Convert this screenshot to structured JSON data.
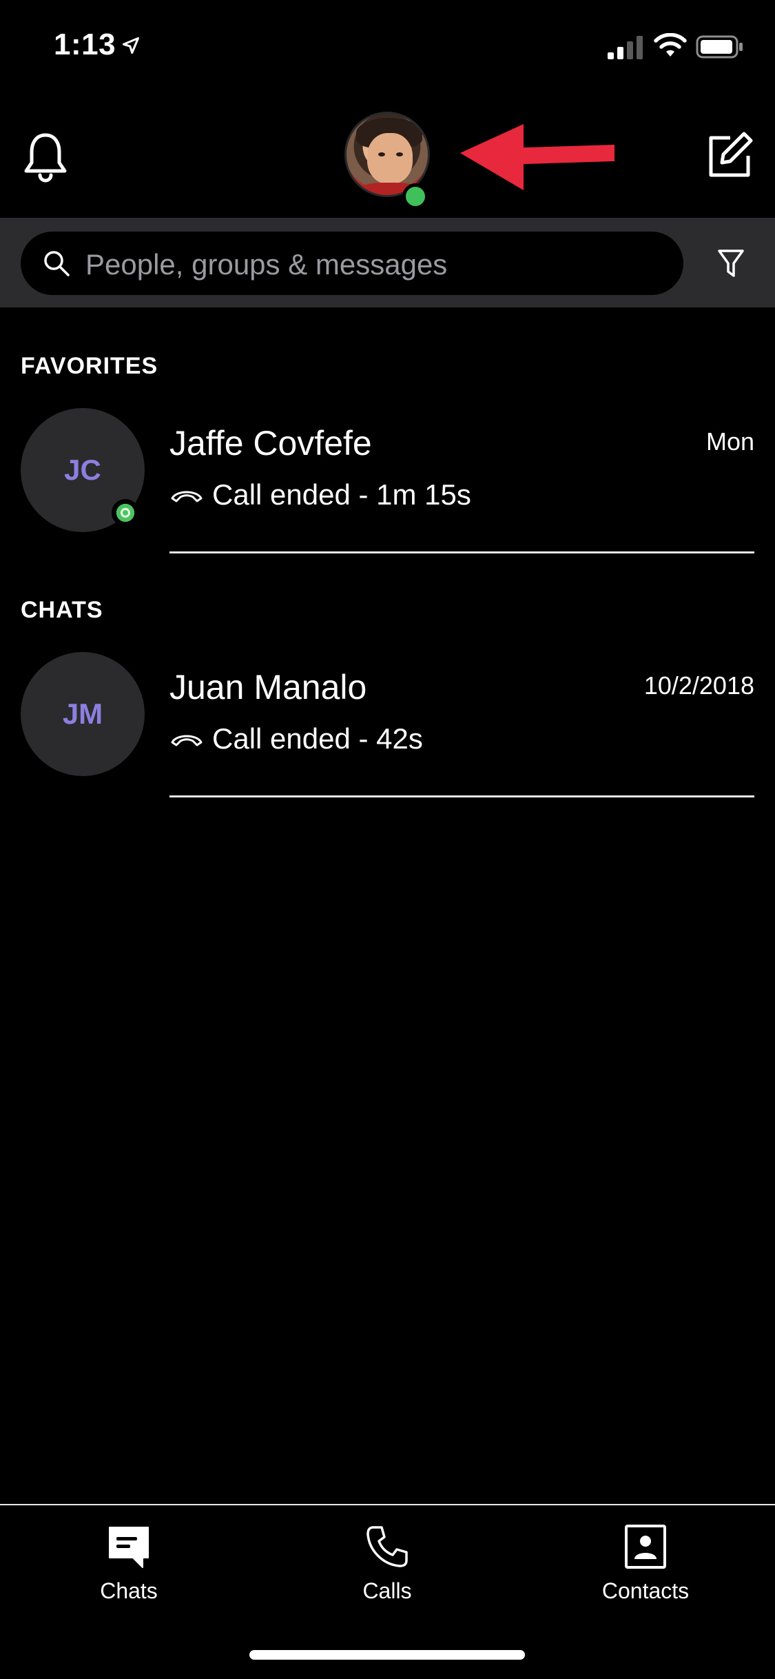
{
  "status_bar": {
    "time": "1:13",
    "icons": [
      "location-arrow-icon",
      "signal-icon",
      "wifi-icon",
      "battery-icon"
    ]
  },
  "header": {
    "left_icon": "bell-icon",
    "right_icon": "compose-icon",
    "profile_status": "online",
    "annotation": "red-arrow pointing to profile avatar"
  },
  "search": {
    "placeholder": "People, groups & messages",
    "filter_icon": "filter-icon"
  },
  "sections": {
    "favorites_label": "FAVORITES",
    "chats_label": "CHATS"
  },
  "favorites": [
    {
      "initials": "JC",
      "name": "Jaffe Covfefe",
      "date": "Mon",
      "subtitle": "Call ended - 1m 15s",
      "online": true
    }
  ],
  "chats": [
    {
      "initials": "JM",
      "name": "Juan Manalo",
      "date": "10/2/2018",
      "subtitle": "Call ended - 42s",
      "online": false
    }
  ],
  "tabs": [
    {
      "label": "Chats",
      "icon": "chat-bubble-icon",
      "active": true
    },
    {
      "label": "Calls",
      "icon": "phone-icon",
      "active": false
    },
    {
      "label": "Contacts",
      "icon": "contact-card-icon",
      "active": false
    }
  ],
  "colors": {
    "background": "#000000",
    "search_band": "#2c2c2f",
    "initials": "#8c7fe0",
    "presence_green": "#3fc05b",
    "arrow_red": "#e8283c"
  }
}
